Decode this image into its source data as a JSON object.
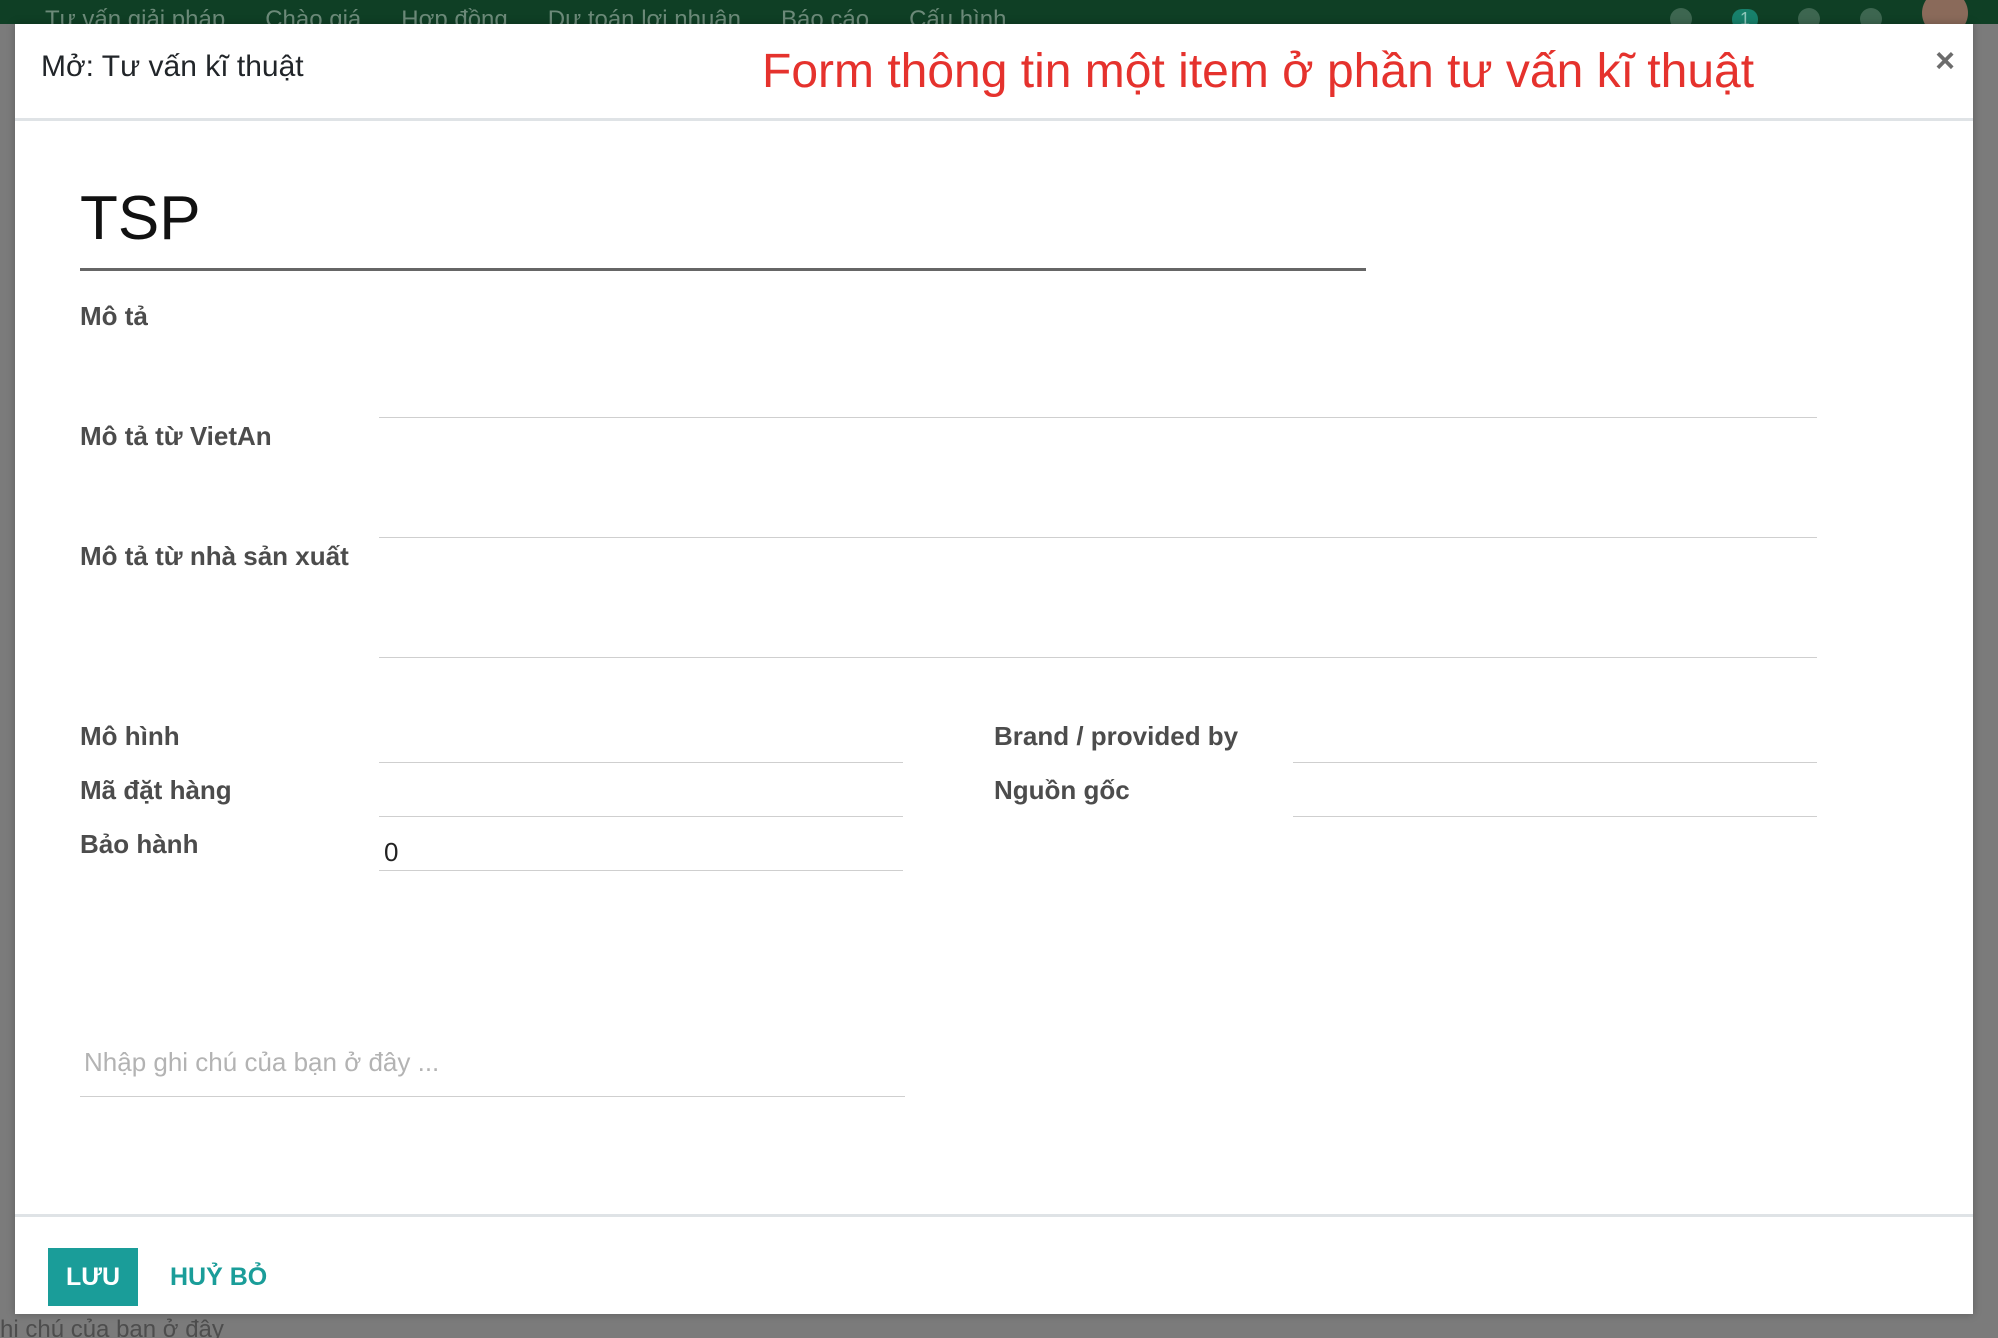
{
  "background": {
    "menu": [
      "Tư vấn giải pháp",
      "Chào giá",
      "Hợp đồng",
      "Dự toán lợi nhuận",
      "Báo cáo",
      "Cấu hình"
    ],
    "badge_count": "1",
    "footer_text": "hi chú của bạn ở đây"
  },
  "modal": {
    "title": "Mở: Tư vấn kĩ thuật",
    "annotation": "Form thông tin một item ở phần tư vấn kĩ thuật",
    "close_symbol": "×",
    "name_value": "TSP",
    "fields": {
      "mo_ta_label": "Mô tả",
      "mo_ta_vietan_label": "Mô tả từ VietAn",
      "mo_ta_nsx_label": "Mô tả từ nhà sản xuất",
      "mo_hinh_label": "Mô hình",
      "ma_dat_hang_label": "Mã đặt hàng",
      "bao_hanh_label": "Bảo hành",
      "bao_hanh_value": "0",
      "brand_label": "Brand / provided by",
      "nguon_goc_label": "Nguồn gốc"
    },
    "note_placeholder": "Nhập ghi chú của bạn ở đây ...",
    "save_label": "LƯU",
    "cancel_label": "HUỶ BỎ"
  }
}
